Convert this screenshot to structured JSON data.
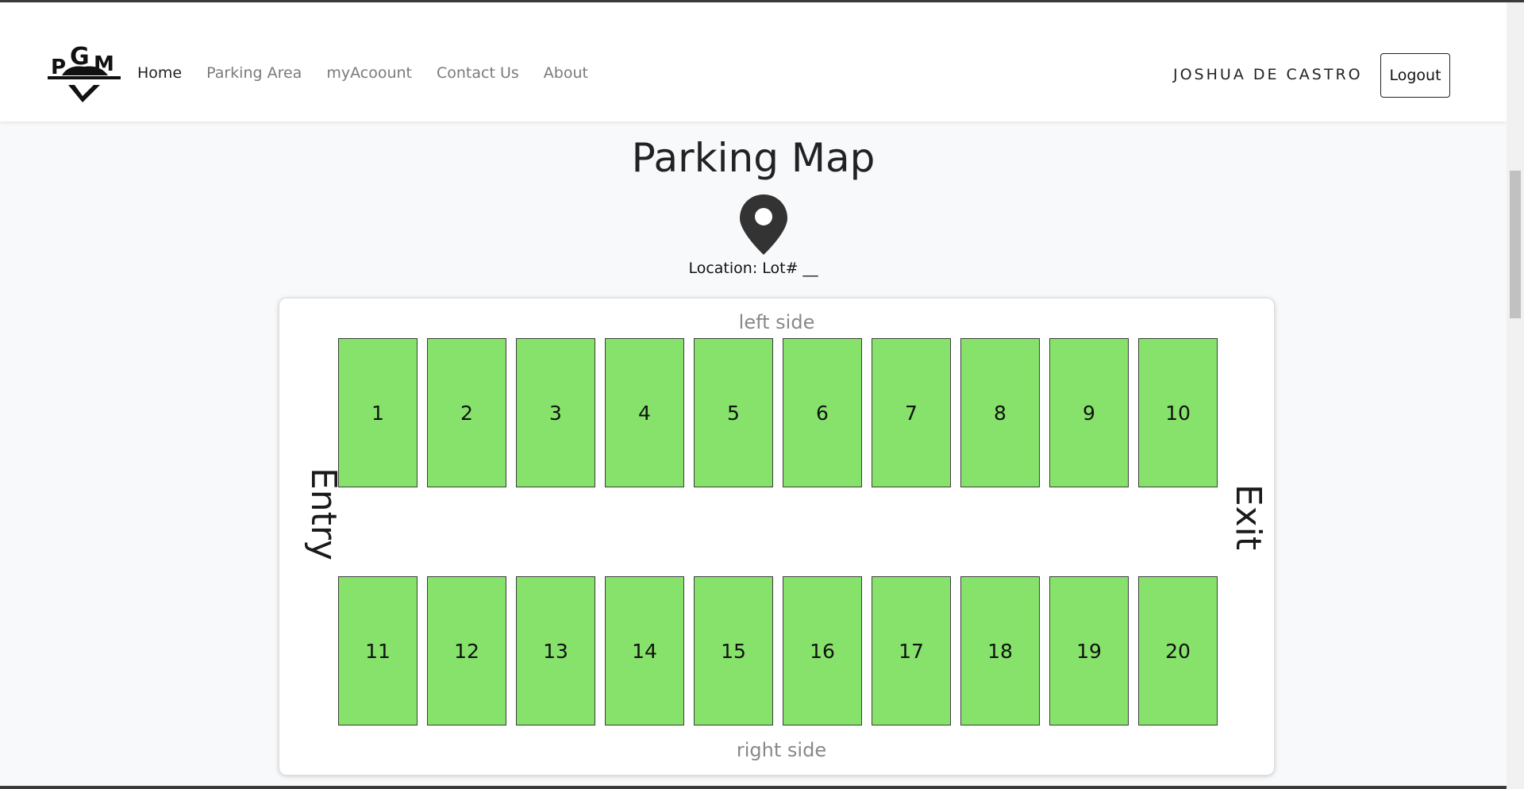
{
  "nav": {
    "brand_icon": "pgm-logo-icon",
    "links": [
      {
        "label": "Home",
        "active": true
      },
      {
        "label": "Parking Area",
        "active": false
      },
      {
        "label": "myAcoount",
        "active": false
      },
      {
        "label": "Contact Us",
        "active": false
      },
      {
        "label": "About",
        "active": false
      }
    ],
    "username": "JOSHUA DE CASTRO",
    "logout_label": "Logout"
  },
  "page": {
    "title": "Parking Map",
    "pin_icon": "map-pin-icon",
    "location": "Location: Lot# __"
  },
  "map": {
    "top_label": "left side",
    "bottom_label": "right side",
    "entry_label": "Entry",
    "exit_label": "Exit",
    "top_row": [
      "1",
      "2",
      "3",
      "4",
      "5",
      "6",
      "7",
      "8",
      "9",
      "10"
    ],
    "bottom_row": [
      "11",
      "12",
      "13",
      "14",
      "15",
      "16",
      "17",
      "18",
      "19",
      "20"
    ],
    "spot_color": "#86e26b"
  }
}
